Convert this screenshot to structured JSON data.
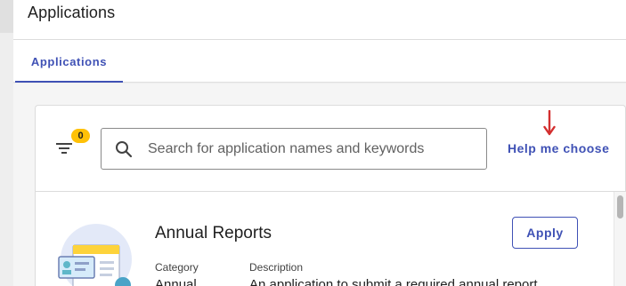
{
  "header": {
    "title": "Applications"
  },
  "tabs": [
    {
      "label": "Applications",
      "active": true
    }
  ],
  "filter": {
    "count": "0",
    "icon": "filter-list-icon",
    "badge_color": "#ffc107"
  },
  "search": {
    "placeholder": "Search for application names and keywords",
    "value": "",
    "icon": "search-icon"
  },
  "help": {
    "label": "Help me choose",
    "arrow_icon": "down-arrow-icon",
    "arrow_color": "#d32f2f"
  },
  "applications": [
    {
      "title": "Annual Reports",
      "apply_label": "Apply",
      "category_label": "Category",
      "category_value": "Annual",
      "description_label": "Description",
      "description_value": "An application to submit a required annual report"
    }
  ],
  "colors": {
    "accent": "#3f51b5",
    "text": "#212121",
    "background": "#f5f5f5"
  }
}
